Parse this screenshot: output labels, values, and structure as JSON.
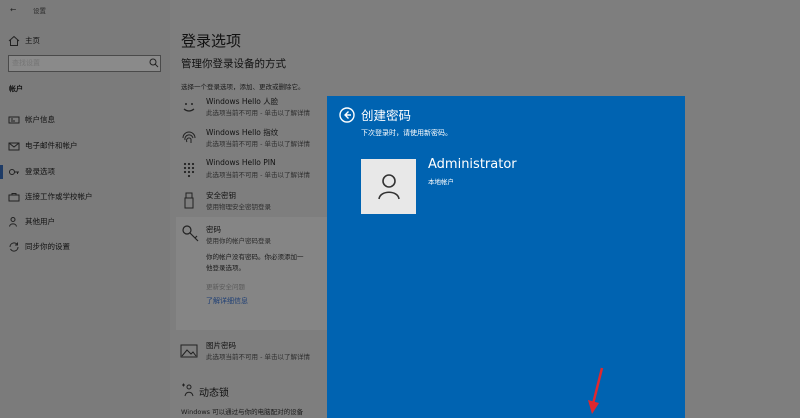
{
  "titlebar": {
    "back_glyph": "←",
    "title": "设置"
  },
  "sidebar": {
    "home_label": "主页",
    "search_placeholder": "查找设置",
    "section_label": "帐户",
    "items": [
      {
        "label": "帐户信息",
        "icon": "person-card-icon"
      },
      {
        "label": "电子邮件和帐户",
        "icon": "mail-icon"
      },
      {
        "label": "登录选项",
        "icon": "key-icon",
        "selected": true
      },
      {
        "label": "连接工作或学校帐户",
        "icon": "briefcase-icon"
      },
      {
        "label": "其他用户",
        "icon": "person-add-icon"
      },
      {
        "label": "同步你的设置",
        "icon": "sync-icon"
      }
    ]
  },
  "main": {
    "title": "登录选项",
    "subtitle": "管理你登录设备的方式",
    "intro": "选择一个登录选项，添加、更改或删除它。",
    "options": [
      {
        "title": "Windows Hello 人脸",
        "sub": "此选项当前不可用 - 单击以了解详情",
        "icon": "face-icon"
      },
      {
        "title": "Windows Hello 指纹",
        "sub": "此选项当前不可用 - 单击以了解详情",
        "icon": "fingerprint-icon"
      },
      {
        "title": "Windows Hello PIN",
        "sub": "此选项当前不可用 - 单击以了解详情",
        "icon": "pin-keypad-icon"
      },
      {
        "title": "安全密钥",
        "sub": "使用物理安全密钥登录",
        "icon": "usb-key-icon"
      }
    ],
    "password": {
      "title": "密码",
      "sub": "使用你的帐户密码登录",
      "desc_line1": "你的帐户没有密码。你必须添加一",
      "desc_line2": "他登录选项。",
      "disabled_link": "更新安全问题",
      "learn_more": "了解详细信息"
    },
    "picture_password": {
      "title": "图片密码",
      "sub": "此选项当前不可用 - 单击以了解详情"
    },
    "dynamic_lock": {
      "title": "动态锁",
      "desc": "Windows 可以通过与你的电脑配对的设备"
    }
  },
  "dialog": {
    "title": "创建密码",
    "subtitle": "下次登录时，请使用新密码。",
    "account_name": "Administrator",
    "account_type": "本地帐户",
    "bg_color": "#0063b1"
  }
}
